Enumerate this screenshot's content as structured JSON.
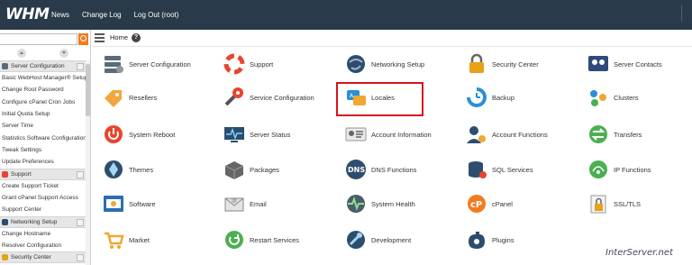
{
  "topbar": {
    "logo": "WHM",
    "nav": [
      "News",
      "Change Log",
      "Log Out (root)"
    ]
  },
  "sidebar": {
    "search": {
      "value": "",
      "placeholder": ""
    },
    "sections": [
      {
        "type": "header",
        "label": "Server Configuration",
        "icon": "server-configuration-icon",
        "color": "#5b6b77"
      },
      {
        "type": "item",
        "label": "Basic WebHost Manager® Setup"
      },
      {
        "type": "item",
        "label": "Change Root Password"
      },
      {
        "type": "item",
        "label": "Configure cPanel Cron Jobs"
      },
      {
        "type": "item",
        "label": "Initial Quota Setup"
      },
      {
        "type": "item",
        "label": "Server Time"
      },
      {
        "type": "item",
        "label": "Statistics Software Configuration"
      },
      {
        "type": "item",
        "label": "Tweak Settings"
      },
      {
        "type": "item",
        "label": "Update Preferences"
      },
      {
        "type": "header",
        "label": "Support",
        "icon": "support-icon",
        "color": "#e8442e"
      },
      {
        "type": "item",
        "label": "Create Support Ticket"
      },
      {
        "type": "item",
        "label": "Grant cPanel Support Access"
      },
      {
        "type": "item",
        "label": "Support Center"
      },
      {
        "type": "header",
        "label": "Networking Setup",
        "icon": "networking-setup-icon",
        "color": "#2d4d6e"
      },
      {
        "type": "item",
        "label": "Change Hostname"
      },
      {
        "type": "item",
        "label": "Resolver Configuration"
      },
      {
        "type": "header",
        "label": "Security Center",
        "icon": "security-center-icon",
        "color": "#e7a21a"
      }
    ]
  },
  "breadcrumb": {
    "home": "Home",
    "help": "?"
  },
  "grid": [
    {
      "label": "Server Configuration",
      "icon": "server-configuration-icon"
    },
    {
      "label": "Support",
      "icon": "support-icon"
    },
    {
      "label": "Networking Setup",
      "icon": "networking-setup-icon"
    },
    {
      "label": "Security Center",
      "icon": "security-center-icon"
    },
    {
      "label": "Server Contacts",
      "icon": "server-contacts-icon"
    },
    {
      "label": "Resellers",
      "icon": "resellers-icon"
    },
    {
      "label": "Service Configuration",
      "icon": "service-configuration-icon"
    },
    {
      "label": "Locales",
      "icon": "locales-icon"
    },
    {
      "label": "Backup",
      "icon": "backup-icon"
    },
    {
      "label": "Clusters",
      "icon": "clusters-icon"
    },
    {
      "label": "System Reboot",
      "icon": "system-reboot-icon"
    },
    {
      "label": "Server Status",
      "icon": "server-status-icon"
    },
    {
      "label": "Account Information",
      "icon": "account-information-icon"
    },
    {
      "label": "Account Functions",
      "icon": "account-functions-icon"
    },
    {
      "label": "Transfers",
      "icon": "transfers-icon"
    },
    {
      "label": "Themes",
      "icon": "themes-icon"
    },
    {
      "label": "Packages",
      "icon": "packages-icon"
    },
    {
      "label": "DNS Functions",
      "icon": "dns-functions-icon"
    },
    {
      "label": "SQL Services",
      "icon": "sql-services-icon"
    },
    {
      "label": "IP Functions",
      "icon": "ip-functions-icon"
    },
    {
      "label": "Software",
      "icon": "software-icon"
    },
    {
      "label": "Email",
      "icon": "email-icon"
    },
    {
      "label": "System Health",
      "icon": "system-health-icon"
    },
    {
      "label": "cPanel",
      "icon": "cpanel-icon"
    },
    {
      "label": "SSL/TLS",
      "icon": "ssl-tls-icon"
    },
    {
      "label": "Market",
      "icon": "market-icon"
    },
    {
      "label": "Restart Services",
      "icon": "restart-services-icon"
    },
    {
      "label": "Development",
      "icon": "development-icon"
    },
    {
      "label": "Plugins",
      "icon": "plugins-icon"
    }
  ],
  "highlighted": "Locales",
  "watermark": "InterServer.net",
  "colors": {
    "topbar": "#293a4a",
    "accent": "#f07c22",
    "highlight": "#d6131b"
  }
}
